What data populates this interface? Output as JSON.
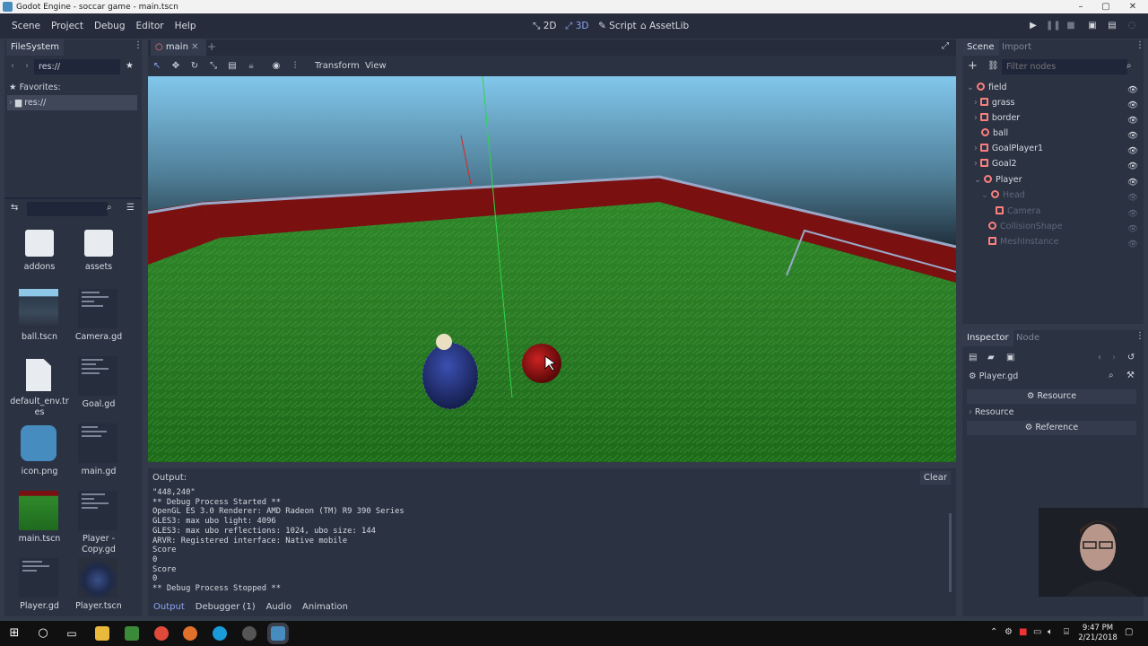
{
  "window": {
    "title": "Godot Engine - soccar game - main.tscn"
  },
  "menu": {
    "items": [
      "Scene",
      "Project",
      "Debug",
      "Editor",
      "Help"
    ]
  },
  "workspaces": {
    "w2d": "2D",
    "w3d": "3D",
    "script": "Script",
    "assetlib": "AssetLib"
  },
  "filesystem": {
    "tab": "FileSystem",
    "path": "res://",
    "favorites_label": "Favorites:",
    "root_label": "res://",
    "files": [
      {
        "name": "addons",
        "kind": "folder"
      },
      {
        "name": "assets",
        "kind": "folder"
      },
      {
        "name": "ball.tscn",
        "kind": "scene"
      },
      {
        "name": "Camera.gd",
        "kind": "script"
      },
      {
        "name": "default_env.tres",
        "kind": "resource"
      },
      {
        "name": "Goal.gd",
        "kind": "script"
      },
      {
        "name": "icon.png",
        "kind": "image"
      },
      {
        "name": "main.gd",
        "kind": "script"
      },
      {
        "name": "main.tscn",
        "kind": "scene"
      },
      {
        "name": "Player - Copy.gd",
        "kind": "script"
      },
      {
        "name": "Player.gd",
        "kind": "script"
      },
      {
        "name": "Player.tscn",
        "kind": "scene"
      }
    ]
  },
  "editor_tab": {
    "name": "main"
  },
  "viewport_toolbar": {
    "transform": "Transform",
    "view": "View"
  },
  "output": {
    "title": "Output:",
    "clear": "Clear",
    "lines": "\"448,240\"\n** Debug Process Started **\nOpenGL ES 3.0 Renderer: AMD Radeon (TM) R9 390 Series\nGLES3: max ubo light: 4096\nGLES3: max ubo reflections: 1024, ubo size: 144\nARVR: Registered interface: Native mobile\nScore\n0\nScore\n0\n** Debug Process Stopped **"
  },
  "bottom_tabs": {
    "output": "Output",
    "debugger": "Debugger (1)",
    "audio": "Audio",
    "animation": "Animation"
  },
  "scene": {
    "tab": "Scene",
    "import_tab": "Import",
    "filter_placeholder": "Filter nodes",
    "nodes": [
      {
        "name": "field",
        "indent": 0
      },
      {
        "name": "grass",
        "indent": 1
      },
      {
        "name": "border",
        "indent": 1
      },
      {
        "name": "ball",
        "indent": 1
      },
      {
        "name": "GoalPlayer1",
        "indent": 1
      },
      {
        "name": "Goal2",
        "indent": 1
      },
      {
        "name": "Player",
        "indent": 1
      },
      {
        "name": "Head",
        "indent": 2
      },
      {
        "name": "Camera",
        "indent": 3
      },
      {
        "name": "CollisionShape",
        "indent": 2
      },
      {
        "name": "MeshInstance",
        "indent": 2
      }
    ]
  },
  "inspector": {
    "tab": "Inspector",
    "node_tab": "Node",
    "object": "Player.gd",
    "resource_btn": "Resource",
    "resource_section": "Resource",
    "reference_btn": "Reference"
  },
  "clock": {
    "time": "9:47 PM",
    "date": "2/21/2018"
  },
  "colors": {
    "accent": "#8da5f3",
    "node_red": "#fc7f7f",
    "sky": "#7ec4ea",
    "grass": "#2f8a2a",
    "wall": "#7a1010"
  }
}
